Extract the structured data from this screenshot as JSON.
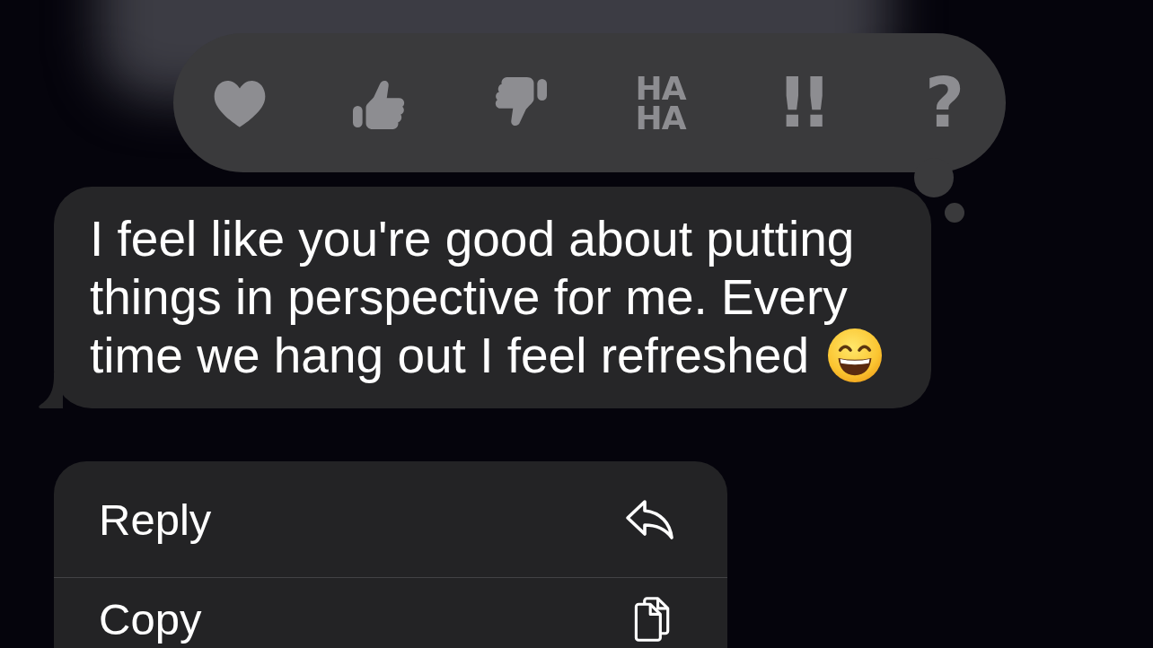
{
  "reaction_bar": {
    "reactions": [
      {
        "kind": "heart",
        "selected": false
      },
      {
        "kind": "thumbs-up",
        "selected": false
      },
      {
        "kind": "thumbs-down",
        "selected": false
      },
      {
        "kind": "stacked-text",
        "label": "HA HA",
        "selected": false
      },
      {
        "kind": "text",
        "label": "!!",
        "selected": false
      },
      {
        "kind": "text",
        "label": "?",
        "selected": false
      }
    ]
  },
  "message": {
    "text": "I feel like you're good about putting things in perspective for me. Every time we hang out I feel refreshed"
  },
  "context_menu": {
    "items": [
      {
        "kind": "reply",
        "label": "Reply"
      },
      {
        "kind": "copy",
        "label": "Copy"
      }
    ]
  }
}
